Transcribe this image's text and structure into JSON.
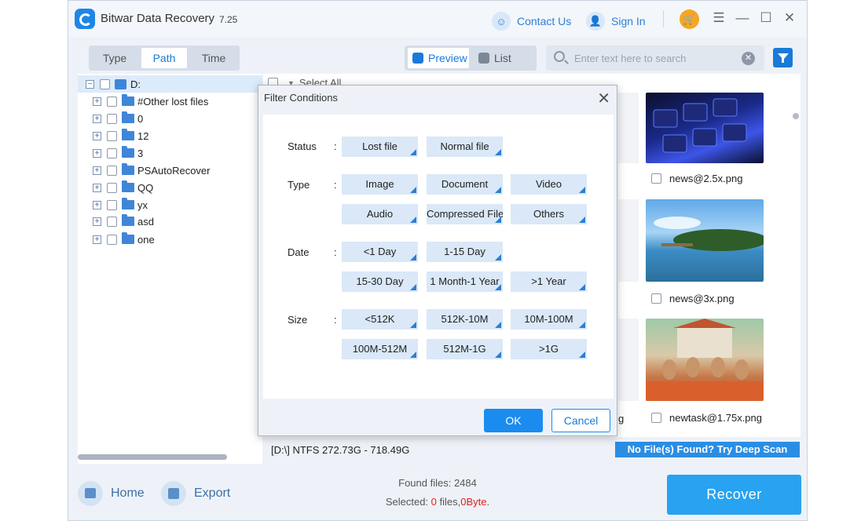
{
  "app": {
    "title": "Bitwar Data Recovery",
    "version": "7.25"
  },
  "titlebar": {
    "contact_label": "Contact Us",
    "signin_label": "Sign In"
  },
  "tabs": [
    {
      "label": "Type"
    },
    {
      "label": "Path"
    },
    {
      "label": "Time"
    }
  ],
  "view": {
    "preview_label": "Preview",
    "list_label": "List"
  },
  "search": {
    "placeholder": "Enter text here to search",
    "value": ""
  },
  "tree": {
    "root": "D:",
    "items": [
      {
        "label": "#Other lost files"
      },
      {
        "label": "0"
      },
      {
        "label": "12"
      },
      {
        "label": "3"
      },
      {
        "label": "PSAutoRecover"
      },
      {
        "label": "QQ"
      },
      {
        "label": "yx"
      },
      {
        "label": "asd"
      },
      {
        "label": "one"
      }
    ]
  },
  "files": {
    "select_all_label": "Select All",
    "items": [
      {
        "name": "news@2.5x.png",
        "icon": "keyboard-image"
      },
      {
        "name": "news@3x.png",
        "icon": "beach-image"
      },
      {
        "name": "newtask@1.75x.png",
        "icon": "rabbits-image"
      }
    ],
    "partial_caption": "g"
  },
  "status": {
    "drive_info": "[D:\\] NTFS 272.73G - 718.49G",
    "deep_scan_label": "No File(s) Found? Try Deep Scan"
  },
  "footer": {
    "home_label": "Home",
    "export_label": "Export",
    "found_label": "Found files:",
    "found_count": "2484",
    "selected_prefix": "Selected:",
    "selected_count": "0",
    "selected_mid": "files,",
    "selected_size": "0Byte",
    "selected_suffix": ".",
    "recover_label": "Recover"
  },
  "filter_dialog": {
    "title": "Filter Conditions",
    "colon": ":",
    "rows": {
      "status": {
        "label": "Status",
        "options": [
          "Lost file",
          "Normal file"
        ]
      },
      "type": {
        "label": "Type",
        "options": [
          "Image",
          "Document",
          "Video",
          "Audio",
          "Compressed File",
          "Others"
        ]
      },
      "date": {
        "label": "Date",
        "options": [
          "<1 Day",
          "1-15 Day",
          "15-30 Day",
          "1 Month-1 Year",
          ">1 Year"
        ]
      },
      "size": {
        "label": "Size",
        "options": [
          "<512K",
          "512K-10M",
          "10M-100M",
          "100M-512M",
          "512M-1G",
          ">1G"
        ]
      }
    },
    "ok_label": "OK",
    "cancel_label": "Cancel"
  },
  "colors": {
    "accent": "#1a7ad8",
    "recover": "#27a3f2",
    "option_bg": "#dae8f8",
    "count_red": "#e02020"
  }
}
